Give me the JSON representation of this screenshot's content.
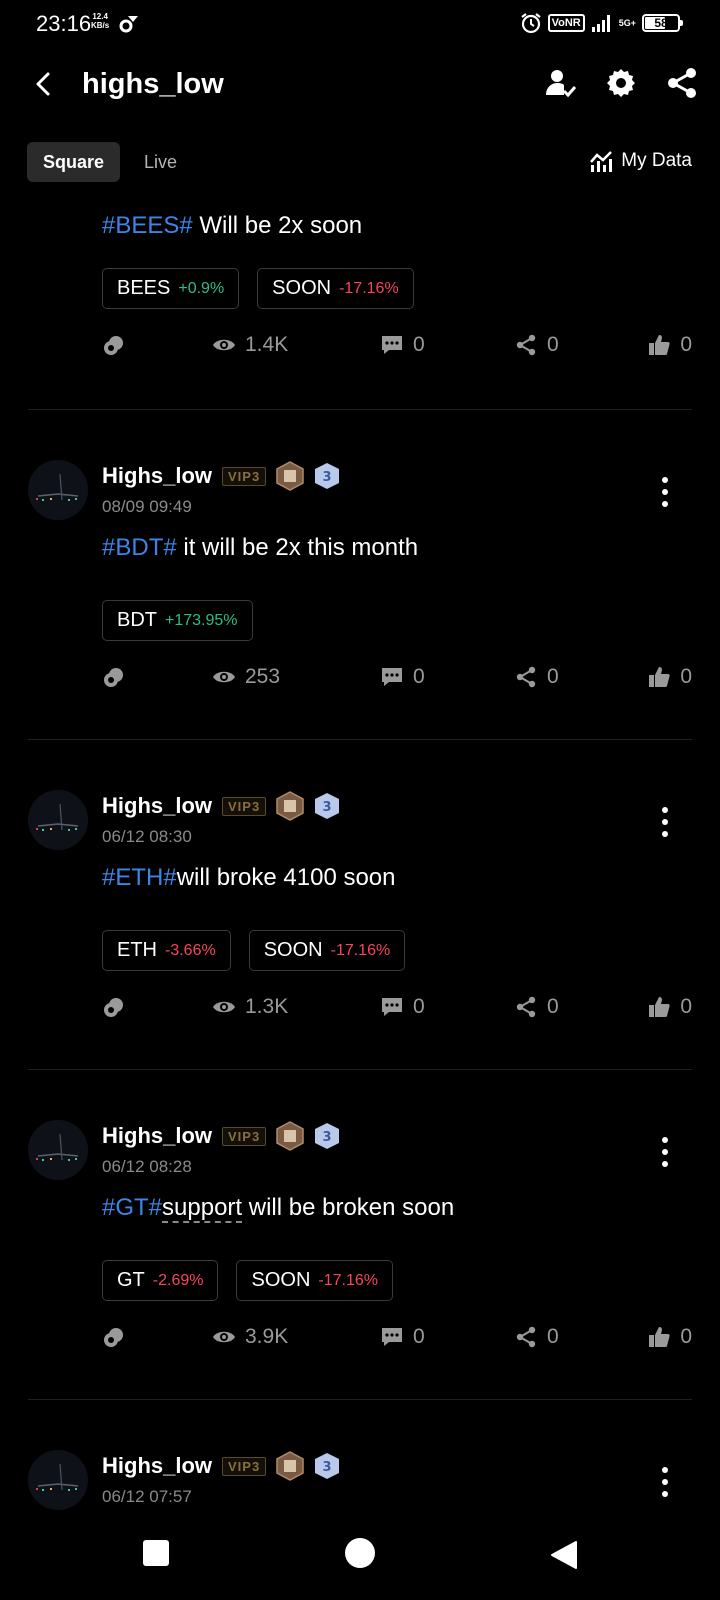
{
  "status_bar": {
    "time": "23:16",
    "speed_value": "12.4",
    "speed_unit": "KB/s",
    "vonr": "VoNR",
    "network": "5G+",
    "battery": "58"
  },
  "header": {
    "title": "highs_low"
  },
  "tabs": [
    {
      "label": "Square",
      "active": true
    },
    {
      "label": "Live",
      "active": false
    }
  ],
  "my_data_label": "My Data",
  "colors": {
    "up": "#2ebd85",
    "down": "#f6465d",
    "tag": "#3b86e8",
    "bg": "#000000"
  },
  "posts": [
    {
      "tag": "#BEES#",
      "text": " Will be 2x soon",
      "chips": [
        {
          "symbol": "BEES",
          "change": "+0.9%",
          "direction": "up"
        },
        {
          "symbol": "SOON",
          "change": "-17.16%",
          "direction": "down"
        }
      ],
      "views": "1.4K",
      "comments": "0",
      "shares": "0",
      "likes": "0"
    },
    {
      "author": "Highs_low",
      "vip": "VIP3",
      "level": "3",
      "time": "08/09 09:49",
      "tag": "#BDT#",
      "text": " it will be 2x this month",
      "chips": [
        {
          "symbol": "BDT",
          "change": "+173.95%",
          "direction": "up"
        }
      ],
      "views": "253",
      "comments": "0",
      "shares": "0",
      "likes": "0"
    },
    {
      "author": "Highs_low",
      "vip": "VIP3",
      "level": "3",
      "time": "06/12 08:30",
      "tag": "#ETH#",
      "text": "will broke 4100 soon",
      "chips": [
        {
          "symbol": "ETH",
          "change": "-3.66%",
          "direction": "down"
        },
        {
          "symbol": "SOON",
          "change": "-17.16%",
          "direction": "down"
        }
      ],
      "views": "1.3K",
      "comments": "0",
      "shares": "0",
      "likes": "0"
    },
    {
      "author": "Highs_low",
      "vip": "VIP3",
      "level": "3",
      "time": "06/12 08:28",
      "tag": "#GT#",
      "link_text": "support",
      "text": " will be broken soon",
      "chips": [
        {
          "symbol": "GT",
          "change": "-2.69%",
          "direction": "down"
        },
        {
          "symbol": "SOON",
          "change": "-17.16%",
          "direction": "down"
        }
      ],
      "views": "3.9K",
      "comments": "0",
      "shares": "0",
      "likes": "0"
    },
    {
      "author": "Highs_low",
      "vip": "VIP3",
      "level": "3",
      "time": "06/12 07:57"
    }
  ],
  "icons": {
    "back": "chevron-left-icon",
    "profile": "user-check-icon",
    "settings": "gear-icon",
    "share": "share-icon",
    "my_data": "chart-icon",
    "repost": "repost-icon",
    "views": "eye-icon",
    "comments": "comment-icon",
    "shares": "share-icon",
    "likes": "thumbs-up-icon",
    "more": "more-vertical-icon"
  }
}
